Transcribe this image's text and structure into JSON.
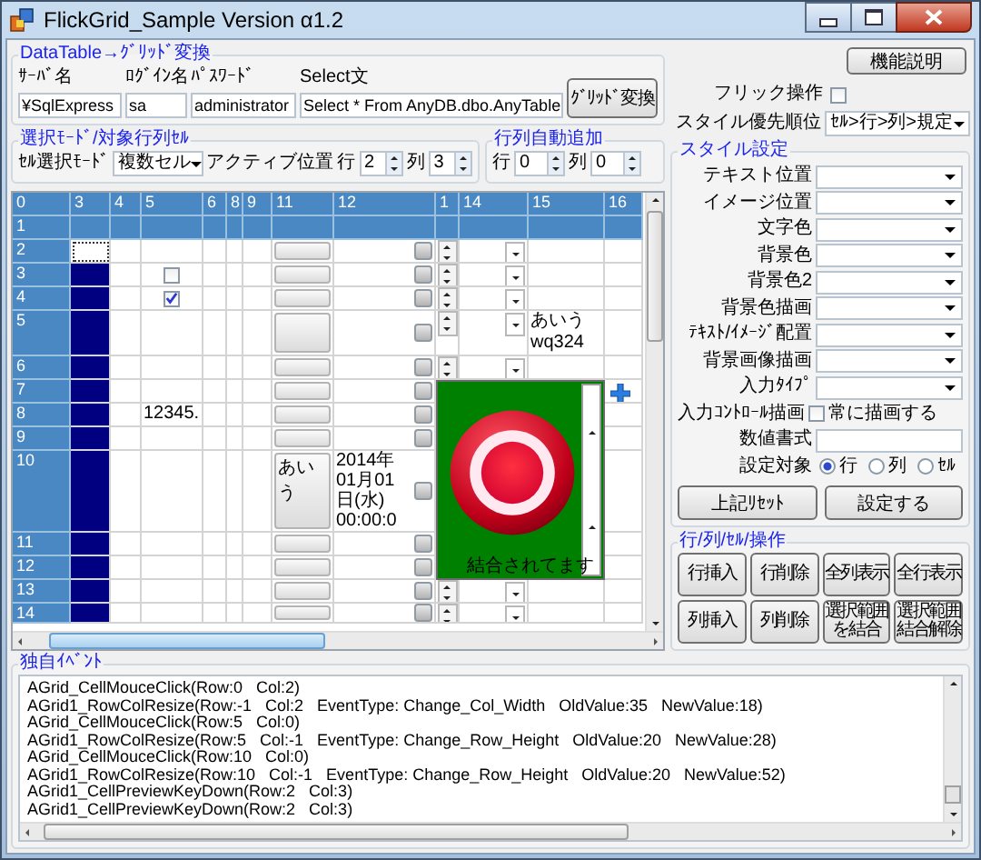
{
  "window": {
    "title": "FlickGrid_Sample Version α1.2"
  },
  "convert": {
    "title": "DataTable→ｸﾞﾘｯﾄﾞ変換",
    "fields": [
      {
        "label": "ｻｰﾊﾞ名",
        "value": "¥SqlExpress"
      },
      {
        "label": "ﾛｸﾞｲﾝ名",
        "value": "sa"
      },
      {
        "label": "ﾊﾟｽﾜｰﾄﾞ",
        "value": "administrator"
      },
      {
        "label": "Select文",
        "value": "Select * From AnyDB.dbo.AnyTable"
      }
    ],
    "button": "ｸﾞﾘｯﾄﾞ変換"
  },
  "selection": {
    "title": "選択ﾓｰﾄﾞ/対象行列ｾﾙ",
    "mode_label": "ｾﾙ選択ﾓｰﾄﾞ",
    "mode_value": "複数セル",
    "active_label": "アクティブ位置",
    "row_label": "行",
    "row_value": "2",
    "col_label": "列",
    "col_value": "3"
  },
  "auto_add": {
    "title": "行列自動追加",
    "row_label": "行",
    "row_value": "0",
    "col_label": "列",
    "col_value": "0"
  },
  "help_button": "機能説明",
  "flick": {
    "label": "フリック操作",
    "checked": false
  },
  "priority": {
    "label": "スタイル優先順位",
    "value": "ｾﾙ>行>列>規定"
  },
  "style": {
    "title": "スタイル設定",
    "dropdowns": [
      "テキスト位置",
      "イメージ位置",
      "文字色",
      "背景色",
      "背景色2",
      "背景色描画",
      "ﾃｷｽﾄ/ｲﾒｰｼﾞ配置",
      "背景画像描画",
      "入力ﾀｲﾌﾟ"
    ],
    "draw_label": "入力ｺﾝﾄﾛｰﾙ描画",
    "always": {
      "label": "常に描画する",
      "checked": false
    },
    "format_label": "数値書式",
    "target_label": "設定対象",
    "targets": [
      {
        "label": "行",
        "selected": true
      },
      {
        "label": "列",
        "selected": false
      },
      {
        "label": "ｾﾙ",
        "selected": false
      }
    ],
    "buttons": [
      "上記ﾘｾｯﾄ",
      "設定する"
    ]
  },
  "operations": {
    "title": "行/列/ｾﾙ/操作",
    "buttons": [
      "行挿入",
      "行削除",
      "全列表示",
      "全行表示",
      "列挿入",
      "列削除",
      "選択範囲を結合",
      "選択範囲結合解除"
    ]
  },
  "grid": {
    "columns": [
      "0",
      "3",
      "4",
      "5",
      "6",
      "8",
      "9",
      "11",
      "12",
      "1",
      "14",
      "15",
      "16"
    ],
    "merge": {
      "text": "結合されてます"
    },
    "rows": [
      {
        "label": "1",
        "kind": "header"
      },
      {
        "label": "2",
        "kind": "data",
        "cells": [
          {
            "kind": "selection",
            "selected": true,
            "active": true
          },
          {
            "kind": "blank"
          },
          {
            "kind": "blank"
          },
          {
            "kind": "blank"
          },
          {
            "kind": "blank"
          },
          {
            "kind": "blank"
          },
          {
            "kind": "button"
          },
          {
            "kind": "date"
          },
          {
            "kind": "spinner"
          },
          {
            "kind": "dropdown"
          },
          {
            "kind": "blank"
          },
          {
            "kind": "blank"
          }
        ]
      },
      {
        "label": "3",
        "kind": "data",
        "cells": [
          {
            "kind": "selection",
            "selected": true,
            "active": false
          },
          {
            "kind": "blank"
          },
          {
            "kind": "checkbox",
            "checked": false
          },
          {
            "kind": "blank"
          },
          {
            "kind": "blank"
          },
          {
            "kind": "blank"
          },
          {
            "kind": "button"
          },
          {
            "kind": "date"
          },
          {
            "kind": "spinner"
          },
          {
            "kind": "dropdown"
          },
          {
            "kind": "blank"
          },
          {
            "kind": "blank"
          }
        ]
      },
      {
        "label": "4",
        "kind": "data",
        "cells": [
          {
            "kind": "selection",
            "selected": true,
            "active": false
          },
          {
            "kind": "blank"
          },
          {
            "kind": "checkbox",
            "checked": true
          },
          {
            "kind": "blank"
          },
          {
            "kind": "blank"
          },
          {
            "kind": "blank"
          },
          {
            "kind": "button"
          },
          {
            "kind": "date"
          },
          {
            "kind": "spinner"
          },
          {
            "kind": "dropdown"
          },
          {
            "kind": "blank"
          },
          {
            "kind": "blank"
          }
        ]
      },
      {
        "label": "5",
        "kind": "data",
        "cells": [
          {
            "kind": "selection",
            "selected": true,
            "active": false
          },
          {
            "kind": "blank"
          },
          {
            "kind": "blank"
          },
          {
            "kind": "blank"
          },
          {
            "kind": "blank"
          },
          {
            "kind": "blank"
          },
          {
            "kind": "button"
          },
          {
            "kind": "date"
          },
          {
            "kind": "spinner"
          },
          {
            "kind": "dropdown"
          },
          {
            "kind": "text",
            "text": "あいう\nwq324"
          },
          {
            "kind": "blank"
          }
        ]
      },
      {
        "label": "6",
        "kind": "data",
        "cells": [
          {
            "kind": "selection",
            "selected": true,
            "active": false
          },
          {
            "kind": "blank"
          },
          {
            "kind": "blank"
          },
          {
            "kind": "blank"
          },
          {
            "kind": "blank"
          },
          {
            "kind": "blank"
          },
          {
            "kind": "button"
          },
          {
            "kind": "date"
          },
          {
            "kind": "spinner"
          },
          {
            "kind": "dropdown"
          },
          {
            "kind": "blank"
          },
          {
            "kind": "blank"
          }
        ]
      },
      {
        "label": "7",
        "kind": "data",
        "cells": [
          {
            "kind": "selection",
            "selected": true,
            "active": false
          },
          {
            "kind": "blank"
          },
          {
            "kind": "blank"
          },
          {
            "kind": "blank"
          },
          {
            "kind": "blank"
          },
          {
            "kind": "blank"
          },
          {
            "kind": "button"
          },
          {
            "kind": "date"
          },
          {
            "kind": "merged"
          },
          {
            "kind": "merged"
          },
          {
            "kind": "merged"
          },
          {
            "kind": "plus"
          }
        ]
      },
      {
        "label": "8",
        "kind": "data",
        "cells": [
          {
            "kind": "selection",
            "selected": true,
            "active": false
          },
          {
            "kind": "blank"
          },
          {
            "kind": "text",
            "text": "12345."
          },
          {
            "kind": "blank"
          },
          {
            "kind": "blank"
          },
          {
            "kind": "blank"
          },
          {
            "kind": "button"
          },
          {
            "kind": "date"
          },
          {
            "kind": "merged"
          },
          {
            "kind": "merged"
          },
          {
            "kind": "merged"
          },
          {
            "kind": "blank"
          }
        ]
      },
      {
        "label": "9",
        "kind": "data",
        "cells": [
          {
            "kind": "selection",
            "selected": true,
            "active": false
          },
          {
            "kind": "blank"
          },
          {
            "kind": "blank"
          },
          {
            "kind": "blank"
          },
          {
            "kind": "blank"
          },
          {
            "kind": "blank"
          },
          {
            "kind": "button"
          },
          {
            "kind": "date"
          },
          {
            "kind": "merged"
          },
          {
            "kind": "merged"
          },
          {
            "kind": "merged"
          },
          {
            "kind": "blank"
          }
        ]
      },
      {
        "label": "10",
        "kind": "data",
        "cells": [
          {
            "kind": "selection",
            "selected": true,
            "active": false
          },
          {
            "kind": "blank"
          },
          {
            "kind": "blank"
          },
          {
            "kind": "blank"
          },
          {
            "kind": "blank"
          },
          {
            "kind": "blank"
          },
          {
            "kind": "button",
            "text": "あいう"
          },
          {
            "kind": "date",
            "text": "2014年\n01月01\n日(水)\n00:00:0"
          },
          {
            "kind": "merged"
          },
          {
            "kind": "merged"
          },
          {
            "kind": "merged"
          },
          {
            "kind": "blank"
          }
        ]
      },
      {
        "label": "11",
        "kind": "data",
        "cells": [
          {
            "kind": "selection",
            "selected": true,
            "active": false
          },
          {
            "kind": "blank"
          },
          {
            "kind": "blank"
          },
          {
            "kind": "blank"
          },
          {
            "kind": "blank"
          },
          {
            "kind": "blank"
          },
          {
            "kind": "button"
          },
          {
            "kind": "date"
          },
          {
            "kind": "merged"
          },
          {
            "kind": "merged"
          },
          {
            "kind": "merged"
          },
          {
            "kind": "blank"
          }
        ]
      },
      {
        "label": "12",
        "kind": "data",
        "cells": [
          {
            "kind": "selection",
            "selected": true,
            "active": false
          },
          {
            "kind": "blank"
          },
          {
            "kind": "blank"
          },
          {
            "kind": "blank"
          },
          {
            "kind": "blank"
          },
          {
            "kind": "blank"
          },
          {
            "kind": "button"
          },
          {
            "kind": "date"
          },
          {
            "kind": "merged"
          },
          {
            "kind": "merged"
          },
          {
            "kind": "merged"
          },
          {
            "kind": "blank"
          }
        ]
      },
      {
        "label": "13",
        "kind": "data",
        "cells": [
          {
            "kind": "selection",
            "selected": true,
            "active": false
          },
          {
            "kind": "blank"
          },
          {
            "kind": "blank"
          },
          {
            "kind": "blank"
          },
          {
            "kind": "blank"
          },
          {
            "kind": "blank"
          },
          {
            "kind": "button"
          },
          {
            "kind": "date"
          },
          {
            "kind": "spinner"
          },
          {
            "kind": "dropdown"
          },
          {
            "kind": "blank"
          },
          {
            "kind": "blank"
          }
        ]
      },
      {
        "label": "14",
        "kind": "data",
        "cells": [
          {
            "kind": "selection",
            "selected": true,
            "active": false
          },
          {
            "kind": "blank"
          },
          {
            "kind": "blank"
          },
          {
            "kind": "blank"
          },
          {
            "kind": "blank"
          },
          {
            "kind": "blank"
          },
          {
            "kind": "button"
          },
          {
            "kind": "date"
          },
          {
            "kind": "spinner"
          },
          {
            "kind": "dropdown"
          },
          {
            "kind": "blank"
          },
          {
            "kind": "blank"
          }
        ]
      }
    ]
  },
  "events": {
    "title": "独自ｲﾍﾞﾝﾄ",
    "lines": [
      "AGrid_CellMouceClick(Row:0   Col:2)",
      "AGrid1_RowColResize(Row:-1   Col:2   EventType: Change_Col_Width   OldValue:35   NewValue:18)",
      "AGrid_CellMouceClick(Row:5   Col:0)",
      "AGrid1_RowColResize(Row:5   Col:-1   EventType: Change_Row_Height   OldValue:20   NewValue:28)",
      "AGrid_CellMouceClick(Row:10   Col:0)",
      "AGrid1_RowColResize(Row:10   Col:-1   EventType: Change_Row_Height   OldValue:20   NewValue:52)",
      "AGrid1_CellPreviewKeyDown(Row:2   Col:3)",
      "AGrid1_CellPreviewKeyDown(Row:2   Col:3)"
    ]
  }
}
